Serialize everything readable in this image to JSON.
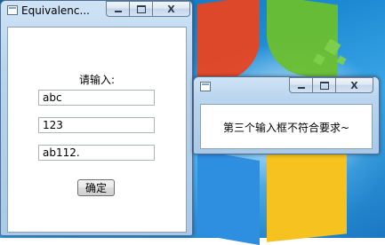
{
  "main_window": {
    "title": "Equivalenc...",
    "prompt": "请输入:",
    "inputs": [
      "abc",
      "123",
      "ab112."
    ],
    "ok_label": "确定",
    "minimize_symbol": "",
    "maximize_symbol": "",
    "close_symbol": "X"
  },
  "dialog": {
    "title": "",
    "message": "第三个输入框不符合要求~",
    "close_symbol": "X"
  },
  "icons": {
    "app_icon": "window-app-icon",
    "minimize": "minimize-icon",
    "maximize": "maximize-icon",
    "close": "close-icon"
  },
  "colors": {
    "titlebar": "#b9d4ee",
    "desktop": "#1d8ad4"
  }
}
